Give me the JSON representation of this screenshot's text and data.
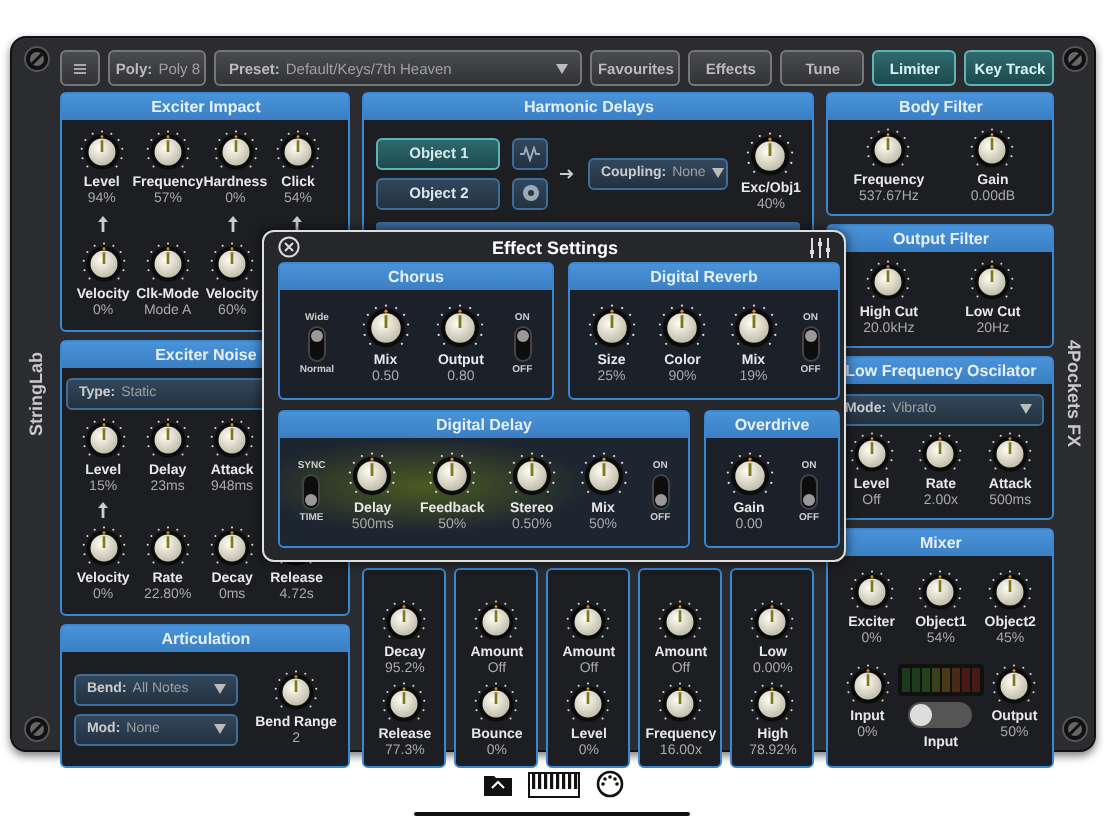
{
  "side_labels": {
    "left": "StringLab",
    "right": "4Pockets FX"
  },
  "toolbar": [
    {
      "kind": "menu",
      "selected": false
    },
    {
      "kind": "field",
      "label": "Poly:",
      "value": "Poly 8"
    },
    {
      "kind": "dropdown",
      "label": "Preset:",
      "value": "Default/Keys/7th Heaven"
    },
    {
      "kind": "button",
      "label": "Favourites",
      "selected": false
    },
    {
      "kind": "button",
      "label": "Effects",
      "selected": false
    },
    {
      "kind": "button",
      "label": "Tune",
      "selected": false
    },
    {
      "kind": "button",
      "label": "Limiter",
      "selected": true
    },
    {
      "kind": "button",
      "label": "Key Track",
      "selected": true
    }
  ],
  "exciter_impact": {
    "title": "Exciter Impact",
    "rows": [
      [
        {
          "label": "Level",
          "value": "94%",
          "arrow": true
        },
        {
          "label": "Frequency",
          "value": "57%",
          "arrow": false
        },
        {
          "label": "Hardness",
          "value": "0%",
          "arrow": true
        },
        {
          "label": "Click",
          "value": "54%",
          "arrow": true
        }
      ],
      [
        {
          "label": "Velocity",
          "value": "0%"
        },
        {
          "label": "Clk-Mode",
          "value": "Mode A"
        },
        {
          "label": "Velocity",
          "value": "60%"
        }
      ]
    ]
  },
  "exciter_noise": {
    "title": "Exciter Noise",
    "type": {
      "label": "Type:",
      "value": "Static"
    },
    "rows": [
      [
        {
          "label": "Level",
          "value": "15%",
          "arrow": true
        },
        {
          "label": "Delay",
          "value": "23ms",
          "arrow": false
        },
        {
          "label": "Attack",
          "value": "948ms",
          "arrow": false
        }
      ],
      [
        {
          "label": "Velocity",
          "value": "0%"
        },
        {
          "label": "Rate",
          "value": "22.80%"
        },
        {
          "label": "Decay",
          "value": "0ms"
        },
        {
          "label": "Release",
          "value": "4.72s"
        }
      ]
    ]
  },
  "articulation": {
    "title": "Articulation",
    "dropdowns": [
      {
        "label": "Bend:",
        "value": "All Notes"
      },
      {
        "label": "Mod:",
        "value": "None"
      }
    ],
    "knob": {
      "label": "Bend Range",
      "value": "2"
    }
  },
  "harmonic_delays": {
    "title": "Harmonic Delays",
    "objects": [
      {
        "label": "Object 1",
        "selected": true
      },
      {
        "label": "Object 2",
        "selected": false
      }
    ],
    "coupling": {
      "label": "Coupling:",
      "value": "None"
    },
    "knob": {
      "label": "Exc/Obj1",
      "value": "40%"
    },
    "subpanels": [
      [
        {
          "label": "Decay",
          "value": "95.2%"
        },
        {
          "label": "Release",
          "value": "77.3%"
        }
      ],
      [
        {
          "label": "Amount",
          "value": "Off"
        },
        {
          "label": "Bounce",
          "value": "0%"
        }
      ],
      [
        {
          "label": "Amount",
          "value": "Off"
        },
        {
          "label": "Level",
          "value": "0%"
        }
      ],
      [
        {
          "label": "Amount",
          "value": "Off"
        },
        {
          "label": "Frequency",
          "value": "16.00x"
        }
      ],
      [
        {
          "label": "Low",
          "value": "0.00%"
        },
        {
          "label": "High",
          "value": "78.92%"
        }
      ]
    ]
  },
  "body_filter": {
    "title": "Body Filter",
    "knobs": [
      {
        "label": "Frequency",
        "value": "537.67Hz"
      },
      {
        "label": "Gain",
        "value": "0.00dB"
      }
    ]
  },
  "output_filter": {
    "title": "Output Filter",
    "knobs": [
      {
        "label": "High Cut",
        "value": "20.0kHz"
      },
      {
        "label": "Low Cut",
        "value": "20Hz"
      }
    ]
  },
  "lfo": {
    "title": "Low Frequency Oscilator",
    "mode": {
      "label": "Mode:",
      "value": "Vibrato"
    },
    "knobs": [
      {
        "label": "Level",
        "value": "Off"
      },
      {
        "label": "Rate",
        "value": "2.00x"
      },
      {
        "label": "Attack",
        "value": "500ms"
      }
    ]
  },
  "mixer": {
    "title": "Mixer",
    "knobs": [
      {
        "label": "Exciter",
        "value": "0%"
      },
      {
        "label": "Object1",
        "value": "54%"
      },
      {
        "label": "Object2",
        "value": "45%"
      }
    ],
    "input": {
      "label": "Input",
      "value": "0%"
    },
    "meter": {
      "level": 0
    },
    "toggle": {
      "label": "Input",
      "on": false
    },
    "output": {
      "label": "Output",
      "value": "50%"
    }
  },
  "effect_settings": {
    "title": "Effect Settings",
    "sections": [
      {
        "title": "Chorus",
        "items": [
          {
            "kind": "switch",
            "top": "Wide",
            "bottom": "Normal",
            "on": true
          },
          {
            "kind": "knob",
            "label": "Mix",
            "value": "0.50"
          },
          {
            "kind": "knob",
            "label": "Output",
            "value": "0.80"
          },
          {
            "kind": "switch",
            "top": "ON",
            "bottom": "OFF",
            "on": true
          }
        ]
      },
      {
        "title": "Digital Reverb",
        "items": [
          {
            "kind": "knob",
            "label": "Size",
            "value": "25%"
          },
          {
            "kind": "knob",
            "label": "Color",
            "value": "90%"
          },
          {
            "kind": "knob",
            "label": "Mix",
            "value": "19%"
          },
          {
            "kind": "switch",
            "top": "ON",
            "bottom": "OFF",
            "on": true
          }
        ]
      },
      {
        "title": "Digital Delay",
        "items": [
          {
            "kind": "switch",
            "top": "SYNC",
            "bottom": "TIME",
            "on": false
          },
          {
            "kind": "knob",
            "label": "Delay",
            "value": "500ms"
          },
          {
            "kind": "knob",
            "label": "Feedback",
            "value": "50%"
          },
          {
            "kind": "knob",
            "label": "Stereo",
            "value": "0.50%"
          },
          {
            "kind": "knob",
            "label": "Mix",
            "value": "50%"
          },
          {
            "kind": "switch",
            "top": "ON",
            "bottom": "OFF",
            "on": false
          }
        ]
      },
      {
        "title": "Overdrive",
        "items": [
          {
            "kind": "knob",
            "label": "Gain",
            "value": "0.00"
          },
          {
            "kind": "switch",
            "top": "ON",
            "bottom": "OFF",
            "on": false
          }
        ]
      }
    ]
  }
}
